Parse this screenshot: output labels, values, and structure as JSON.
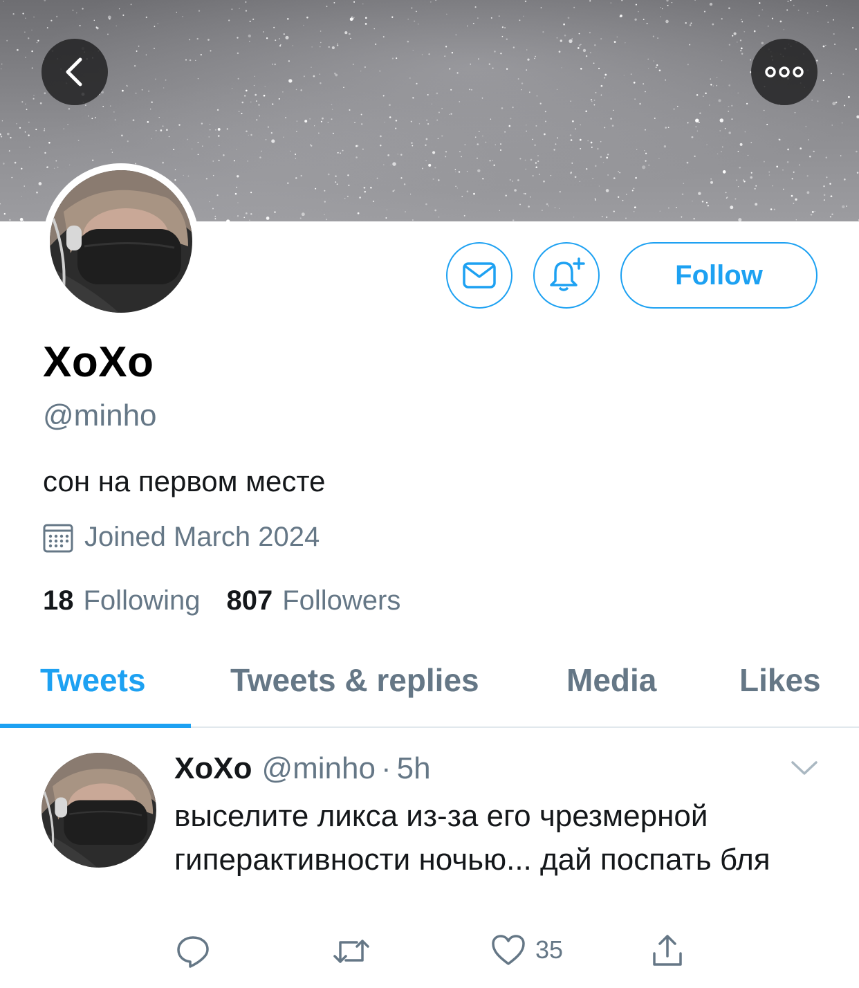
{
  "colors": {
    "accent": "#1da1f2",
    "secondary_text": "#657786",
    "primary_text": "#14171a",
    "divider": "#e1e8ed"
  },
  "header": {
    "back_icon": "chevron-left-icon",
    "more_icon": "more-horizontal-icon"
  },
  "profile": {
    "display_name": "XoXo",
    "handle": "@minho",
    "bio": "сон на первом месте",
    "joined": "Joined March 2024",
    "following_count": "18",
    "following_label": "Following",
    "followers_count": "807",
    "followers_label": "Followers"
  },
  "actions": {
    "message_icon": "envelope-icon",
    "notify_icon": "bell-plus-icon",
    "follow_label": "Follow"
  },
  "tabs": [
    {
      "label": "Tweets",
      "active": true
    },
    {
      "label": "Tweets & replies",
      "active": false
    },
    {
      "label": "Media",
      "active": false
    },
    {
      "label": "Likes",
      "active": false
    }
  ],
  "tweet": {
    "name": "XoXo",
    "handle": "@minho",
    "separator": "·",
    "time": "5h",
    "text": "выселите ликса из-за его чрезмерной гиперактивности ночью... дай поспать бля",
    "reply_count": "",
    "retweet_count": "",
    "like_count": "35"
  }
}
